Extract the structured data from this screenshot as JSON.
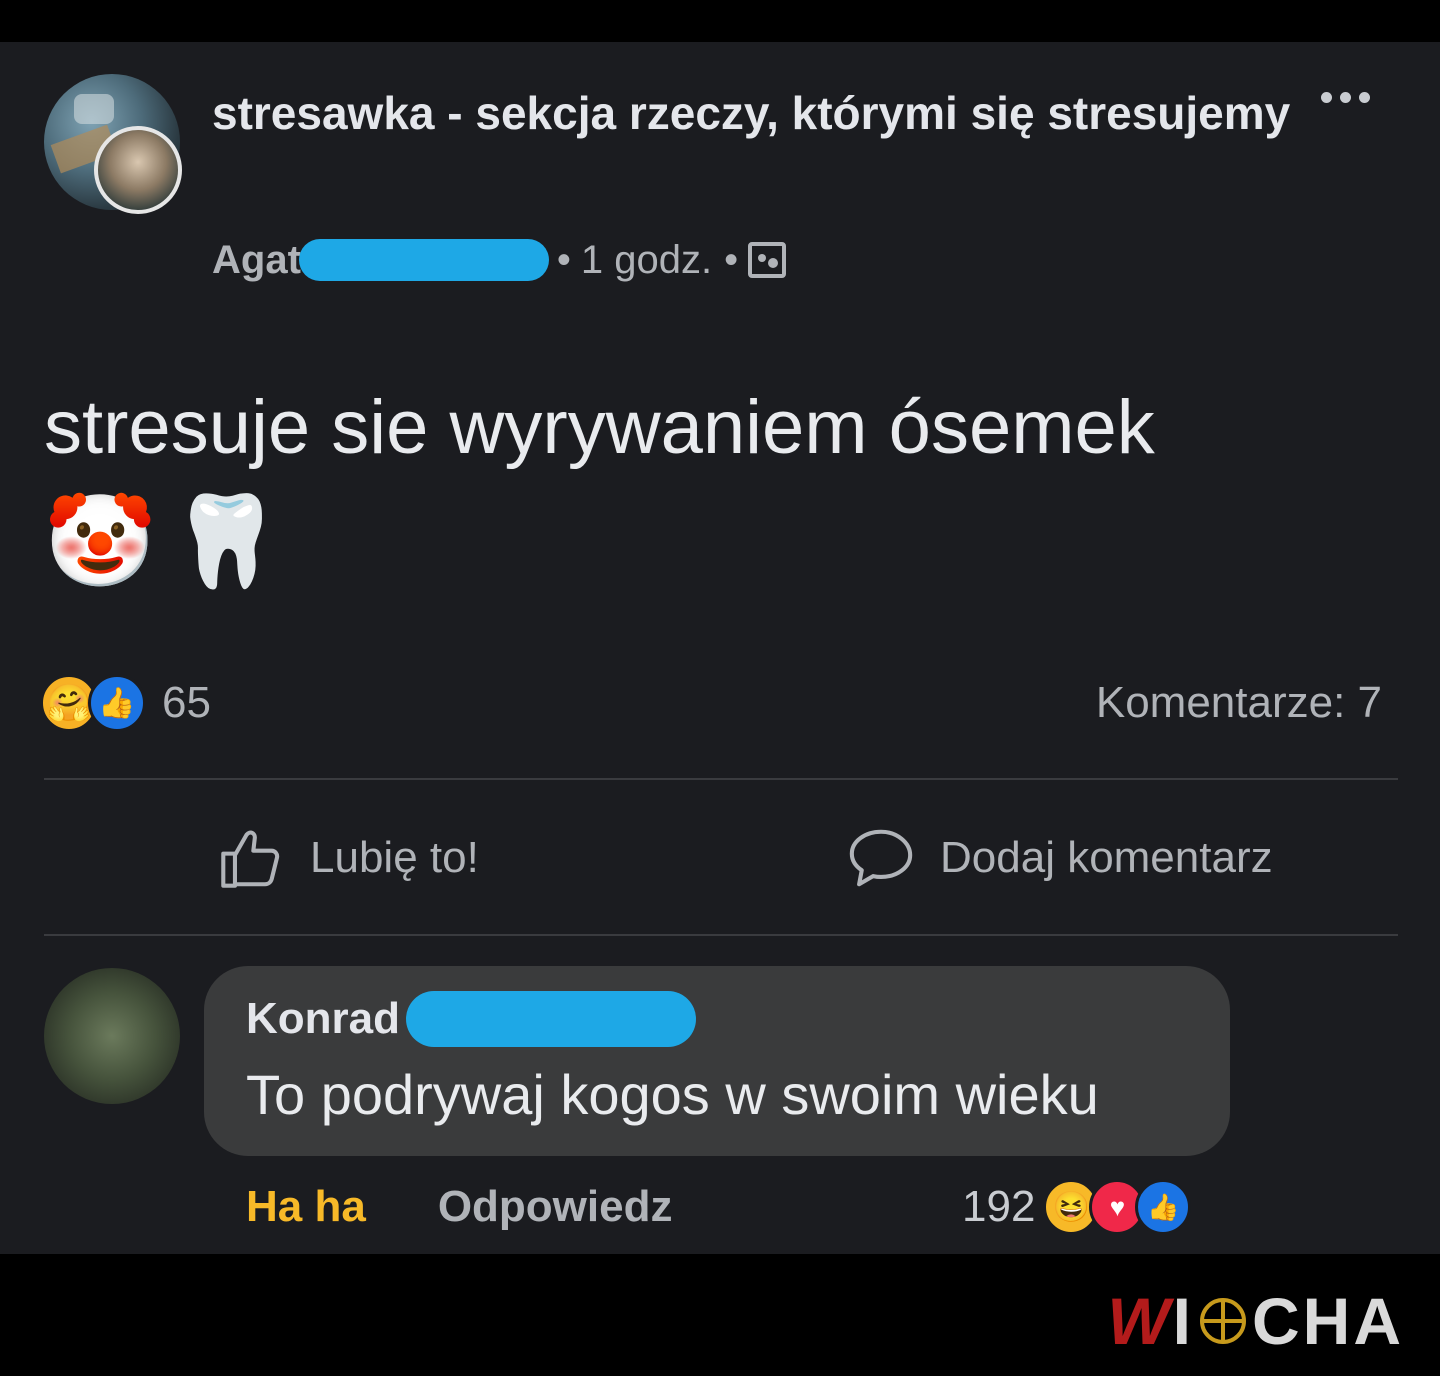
{
  "post": {
    "group_name": "stresawka - sekcja rzeczy, którymi się stresujemy",
    "author": "Agat",
    "time": "1 godz.",
    "separator": "•",
    "text": "stresuje sie wyrywaniem ósemek",
    "emojis": [
      "🤡",
      "🦷"
    ],
    "reaction_count": "65",
    "comments_label": "Komentarze: 7",
    "actions": {
      "like": "Lubię to!",
      "comment": "Dodaj komentarz"
    }
  },
  "comment": {
    "author": "Konrad",
    "text": "To podrywaj kogos w swoim wieku",
    "haha_label": "Ha ha",
    "reply_label": "Odpowiedz",
    "reaction_count": "192"
  },
  "watermark": {
    "part1": "W",
    "part2": "I",
    "part3": "CHA"
  },
  "colors": {
    "background": "#1b1c20",
    "accent_blue": "#1b74e4",
    "redaction": "#1ea8e6",
    "haha_yellow": "#f7b928"
  }
}
